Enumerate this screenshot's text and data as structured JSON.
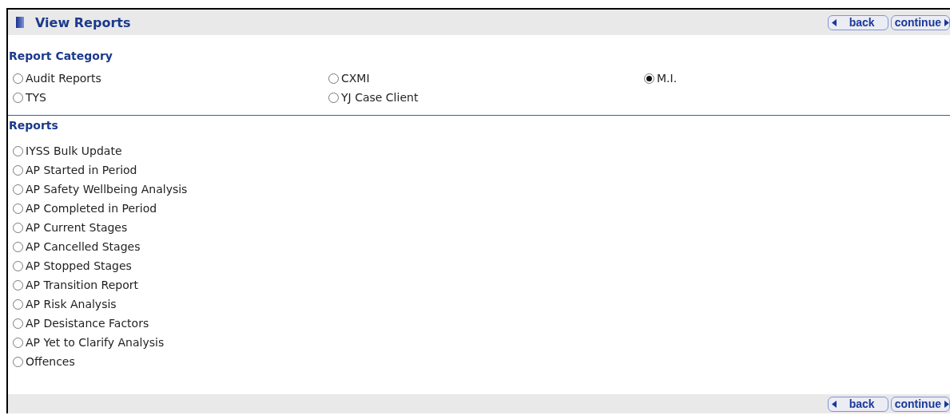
{
  "header": {
    "title": "View Reports",
    "buttons": [
      {
        "label": "back",
        "kind": "back"
      },
      {
        "label": "continue",
        "kind": "continue"
      }
    ]
  },
  "report_category": {
    "title": "Report Category",
    "options": [
      {
        "label": "Audit Reports",
        "selected": false
      },
      {
        "label": "CXMI",
        "selected": false
      },
      {
        "label": "M.I.",
        "selected": true
      },
      {
        "label": "TYS",
        "selected": false
      },
      {
        "label": "YJ Case Client",
        "selected": false
      }
    ]
  },
  "reports": {
    "title": "Reports",
    "options": [
      {
        "label": "IYSS Bulk Update",
        "selected": false
      },
      {
        "label": "AP Started in Period",
        "selected": false
      },
      {
        "label": "AP Safety Wellbeing Analysis",
        "selected": false
      },
      {
        "label": "AP Completed in Period",
        "selected": false
      },
      {
        "label": "AP Current Stages",
        "selected": false
      },
      {
        "label": "AP Cancelled Stages",
        "selected": false
      },
      {
        "label": "AP Stopped Stages",
        "selected": false
      },
      {
        "label": "AP Transition Report",
        "selected": false
      },
      {
        "label": "AP Risk Analysis",
        "selected": false
      },
      {
        "label": "AP Desistance Factors",
        "selected": false
      },
      {
        "label": "AP Yet to Clarify Analysis",
        "selected": false
      },
      {
        "label": "Offences",
        "selected": false
      }
    ]
  },
  "footer": {
    "buttons": [
      {
        "label": "back",
        "kind": "back"
      },
      {
        "label": "continue",
        "kind": "continue"
      }
    ]
  }
}
